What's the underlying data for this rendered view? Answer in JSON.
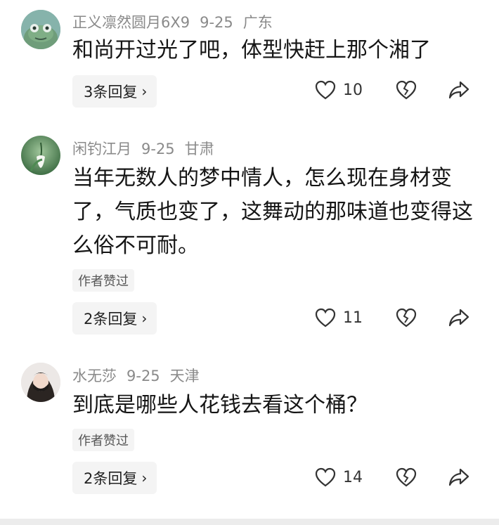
{
  "comments": [
    {
      "username": "正义凛然圆月6X9",
      "date": "9-25",
      "location": "广东",
      "text": "和尚开过光了吧，体型快赶上那个湘了",
      "author_liked": "",
      "replies_label": "3条回复",
      "likes": "10",
      "avatar": "frog-avatar"
    },
    {
      "username": "闲钓江月",
      "date": "9-25",
      "location": "甘肃",
      "text": "当年无数人的梦中情人，怎么现在身材变了，气质也变了，这舞动的那味道也变得这么俗不可耐。",
      "author_liked": "作者赞过",
      "replies_label": "2条回复",
      "likes": "11",
      "avatar": "flower-avatar"
    },
    {
      "username": "水无莎",
      "date": "9-25",
      "location": "天津",
      "text": "到底是哪些人花钱去看这个桶？",
      "author_liked": "作者赞过",
      "replies_label": "2条回复",
      "likes": "14",
      "avatar": "masked-person-avatar"
    }
  ],
  "icons": {
    "like": "heart-icon",
    "dislike": "broken-heart-icon",
    "share": "share-arrow-icon",
    "chevron": "chevron-right-icon"
  },
  "colors": {
    "meta_text": "#8a8a8a",
    "reply_bg": "#f4f4f4"
  }
}
